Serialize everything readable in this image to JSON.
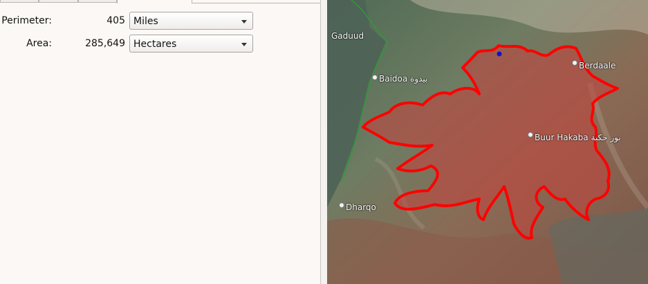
{
  "measure": {
    "perimeter": {
      "label": "Perimeter:",
      "value": "405",
      "unit": "Miles"
    },
    "area": {
      "label": "Area:",
      "value": "285,649",
      "unit": "Hectares"
    }
  },
  "map": {
    "places": {
      "gaduud": "Gaduud",
      "baidoa": "Baidoa بيدوة",
      "berdaale": "Berdaale",
      "buur_hakaba": "Buur Hakaba بور حكبة",
      "dharqo": "Dharqo"
    },
    "colors": {
      "polygon_outline": "#ff0000",
      "polygon_fill": "#c0463f",
      "vertex_marker": "#1010d0"
    }
  }
}
